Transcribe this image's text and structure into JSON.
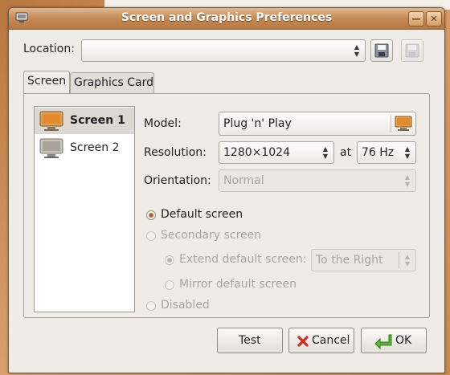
{
  "window": {
    "title": "Screen and Graphics Preferences"
  },
  "location": {
    "label": "Location:",
    "value": ""
  },
  "tabs": [
    {
      "label": "Screen"
    },
    {
      "label": "Graphics Card"
    }
  ],
  "screens": [
    {
      "label": "Screen 1"
    },
    {
      "label": "Screen 2"
    }
  ],
  "model": {
    "label": "Model:",
    "value": "Plug 'n' Play"
  },
  "resolution": {
    "label": "Resolution:",
    "value": "1280×1024",
    "at_label": "at",
    "refresh": "76 Hz"
  },
  "orientation": {
    "label": "Orientation:",
    "value": "Normal"
  },
  "options": {
    "default_screen": "Default screen",
    "secondary_screen": "Secondary screen",
    "extend": "Extend default screen:",
    "extend_value": "To the Right",
    "mirror": "Mirror default screen",
    "disabled": "Disabled"
  },
  "buttons": {
    "test": "Test",
    "cancel": "Cancel",
    "ok": "OK"
  },
  "colors": {
    "accent": "#c0642a",
    "titlebar": "#c48a55"
  }
}
